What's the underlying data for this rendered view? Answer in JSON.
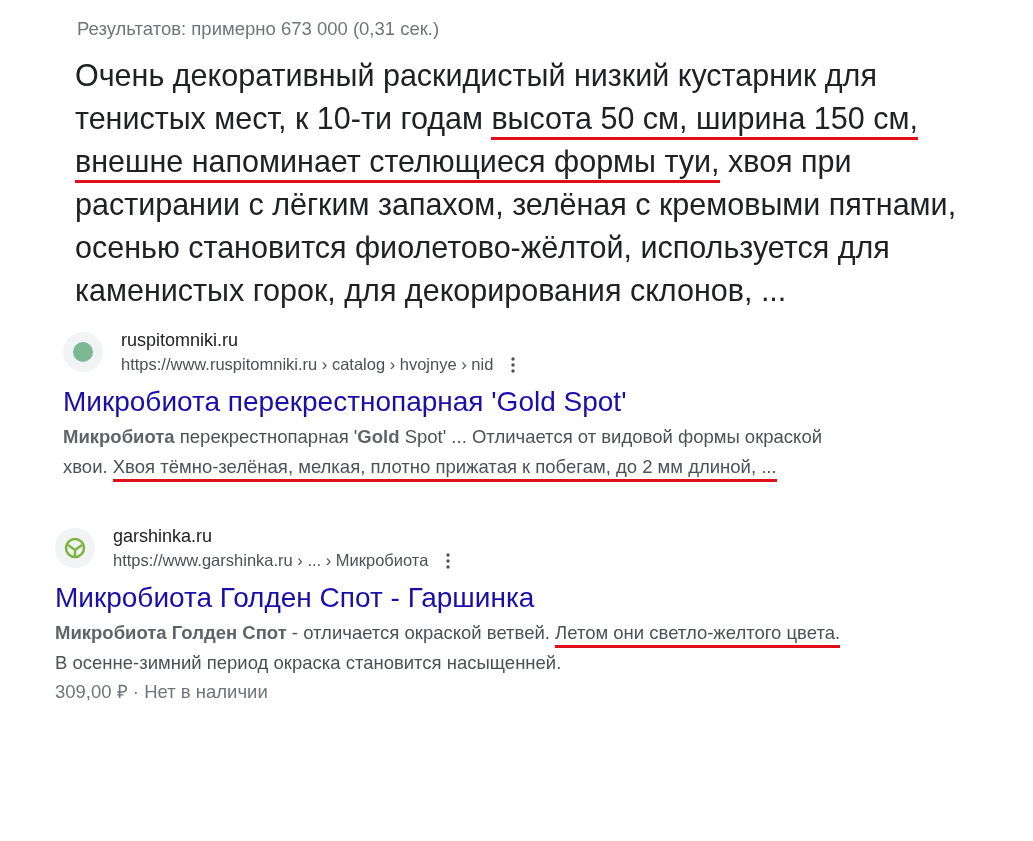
{
  "stats": "Результатов: примерно 673 000 (0,31 сек.)",
  "featured_snippet": [
    {
      "text": "Очень декоративный раскидистый низкий кустарник для тенистых мест, к 10-ти годам ",
      "underlined": false
    },
    {
      "text": "высота 50 см, ширина 150 см, ",
      "underlined": true
    },
    {
      "text": "внешне напоминает стелющиеся формы туи,",
      "underlined": true
    },
    {
      "text": " хвоя при растирании с лёгким запахом, зелёная с кремовыми пятнами, осенью становится фиолетово-жёлтой, используется для каменистых горок, для декорирования склонов, ...",
      "underlined": false
    }
  ],
  "results": [
    {
      "site": "ruspitomniki.ru",
      "url": "https://www.ruspitomniki.ru › catalog › hvojnye › nid",
      "title": "Микробиота перекрестнопарная 'Gold Spot'",
      "snippet": [
        {
          "text": "**Микробиота** перекрестнопарная '**Gold** Spot' ... Отличается от видовой формы окраской хвои. ",
          "underlined": false
        },
        {
          "text": "Хвоя тёмно-зелёная, мелкая, плотно прижатая к побегам, до 2 мм длиной, ...",
          "underlined": true
        }
      ]
    },
    {
      "site": "garshinka.ru",
      "url": "https://www.garshinka.ru › ... › Микробиота",
      "title": "Микробиота Голден Спот - Гаршинка",
      "snippet": [
        {
          "text": "**Микробиота Голден Спот** - отличается окраской ветвей. ",
          "underlined": false
        },
        {
          "text": "Летом они светло-желтого цвета.",
          "underlined": true
        },
        {
          "text": " В осенне-зимний период окраска становится насыщенней.",
          "underlined": false
        }
      ],
      "meta": "309,00 ₽ · Нет в наличии"
    }
  ]
}
